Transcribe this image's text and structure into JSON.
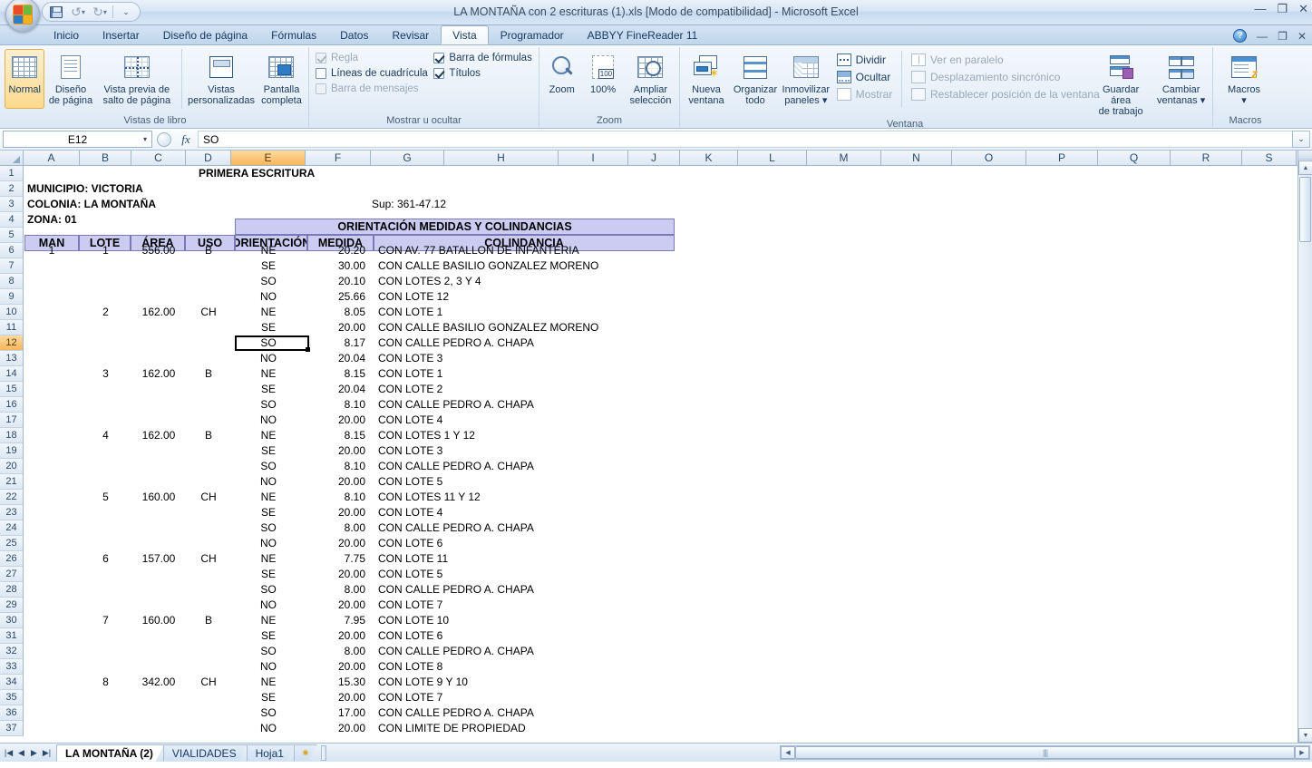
{
  "window": {
    "title": "LA MONTAÑA con 2 escrituras (1).xls  [Modo de compatibilidad] - Microsoft Excel",
    "minimize": "—",
    "restore": "❐",
    "close": "✕",
    "app_minimize": "—",
    "app_restore": "❐",
    "app_close": "✕",
    "help": "?"
  },
  "quick_access": {
    "save": "save-icon",
    "undo": "↺",
    "redo": "↻",
    "customize": "⌄"
  },
  "tabs": [
    {
      "label": "Inicio",
      "active": false
    },
    {
      "label": "Insertar",
      "active": false
    },
    {
      "label": "Diseño de página",
      "active": false
    },
    {
      "label": "Fórmulas",
      "active": false
    },
    {
      "label": "Datos",
      "active": false
    },
    {
      "label": "Revisar",
      "active": false
    },
    {
      "label": "Vista",
      "active": true
    },
    {
      "label": "Programador",
      "active": false
    },
    {
      "label": "ABBYY FineReader 11",
      "active": false
    }
  ],
  "ribbon": {
    "groups": [
      {
        "name": "Vistas de libro",
        "label": "Vistas de libro",
        "buttons": [
          {
            "label_line1": "Normal",
            "label_line2": "",
            "selected": true
          },
          {
            "label_line1": "Diseño",
            "label_line2": "de página",
            "selected": false
          },
          {
            "label_line1": "Vista previa de",
            "label_line2": "salto de página",
            "selected": false
          },
          {
            "label_line1": "Vistas",
            "label_line2": "personalizadas",
            "selected": false
          },
          {
            "label_line1": "Pantalla",
            "label_line2": "completa",
            "selected": false
          }
        ]
      },
      {
        "name": "Mostrar u ocultar",
        "label": "Mostrar u ocultar",
        "checkboxes": [
          {
            "label": "Regla",
            "checked": true,
            "disabled": true
          },
          {
            "label": "Líneas de cuadrícula",
            "checked": false,
            "disabled": false
          },
          {
            "label": "Barra de mensajes",
            "checked": false,
            "disabled": true
          },
          {
            "label": "Barra de fórmulas",
            "checked": true,
            "disabled": false
          },
          {
            "label": "Títulos",
            "checked": true,
            "disabled": false
          }
        ]
      },
      {
        "name": "Zoom",
        "label": "Zoom",
        "buttons": [
          {
            "label_line1": "Zoom",
            "label_line2": ""
          },
          {
            "label_line1": "100%",
            "label_line2": ""
          },
          {
            "label_line1": "Ampliar",
            "label_line2": "selección"
          }
        ]
      },
      {
        "name": "Ventana",
        "label": "Ventana",
        "buttons": [
          {
            "label_line1": "Nueva",
            "label_line2": "ventana"
          },
          {
            "label_line1": "Organizar",
            "label_line2": "todo"
          },
          {
            "label_line1": "Inmovilizar",
            "label_line2": "paneles ▾"
          }
        ],
        "small_buttons": [
          {
            "label": "Dividir",
            "disabled": false
          },
          {
            "label": "Ocultar",
            "disabled": false
          },
          {
            "label": "Mostrar",
            "disabled": true
          },
          {
            "label": "Ver en paralelo",
            "disabled": true
          },
          {
            "label": "Desplazamiento sincrónico",
            "disabled": true
          },
          {
            "label": "Restablecer posición de la ventana",
            "disabled": true
          }
        ],
        "buttons2": [
          {
            "label_line1": "Guardar área",
            "label_line2": "de trabajo"
          },
          {
            "label_line1": "Cambiar",
            "label_line2": "ventanas ▾"
          }
        ]
      },
      {
        "name": "Macros",
        "label": "Macros",
        "buttons": [
          {
            "label_line1": "Macros",
            "label_line2": "▾"
          }
        ]
      }
    ]
  },
  "formula_bar": {
    "name_box": "E12",
    "name_box_caret": "▾",
    "fx": "fx",
    "value": "SO",
    "expand": "⌄"
  },
  "grid": {
    "column_headers": [
      "A",
      "B",
      "C",
      "D",
      "E",
      "F",
      "G",
      "H",
      "I",
      "J",
      "K",
      "L",
      "M",
      "N",
      "O",
      "P",
      "Q",
      "R",
      "S"
    ],
    "selected_column": "E",
    "selected_row": 12,
    "selected_cell": "E12",
    "row_numbers": [
      1,
      2,
      3,
      4,
      5,
      6,
      7,
      8,
      9,
      10,
      11,
      12,
      13,
      14,
      15,
      16,
      17,
      18,
      19,
      20,
      21,
      22,
      23,
      24,
      25,
      26,
      27,
      28,
      29,
      30,
      31,
      32,
      33,
      34,
      35,
      36,
      37
    ],
    "titles": {
      "primera_escritura": "PRIMERA ESCRITURA",
      "municipio": "MUNICIPIO: VICTORIA",
      "colonia": "COLONIA: LA MONTAÑA",
      "zona": "ZONA: 01",
      "sup": "Sup: 361-47.12",
      "band": "ORIENTACIÓN MEDIDAS Y COLINDANCIAS"
    },
    "table_headers": [
      "MAN",
      "LOTE",
      "ÁREA",
      "USO",
      "ORIENTACIÓN",
      "MEDIDA",
      "COLINDANCIA"
    ],
    "rows": [
      {
        "row": 6,
        "man": "1",
        "lote": "1",
        "area": "556.00",
        "uso": "B",
        "orient": "NE",
        "medida": "20.20",
        "colindancia": "CON AV. 77 BATALLON DE INFANTERIA"
      },
      {
        "row": 7,
        "man": "",
        "lote": "",
        "area": "",
        "uso": "",
        "orient": "SE",
        "medida": "30.00",
        "colindancia": "CON CALLE BASILIO GONZALEZ MORENO"
      },
      {
        "row": 8,
        "man": "",
        "lote": "",
        "area": "",
        "uso": "",
        "orient": "SO",
        "medida": "20.10",
        "colindancia": "CON LOTES 2, 3 Y 4"
      },
      {
        "row": 9,
        "man": "",
        "lote": "",
        "area": "",
        "uso": "",
        "orient": "NO",
        "medida": "25.66",
        "colindancia": "CON LOTE 12"
      },
      {
        "row": 10,
        "man": "",
        "lote": "2",
        "area": "162.00",
        "uso": "CH",
        "orient": "NE",
        "medida": "8.05",
        "colindancia": "CON LOTE 1"
      },
      {
        "row": 11,
        "man": "",
        "lote": "",
        "area": "",
        "uso": "",
        "orient": "SE",
        "medida": "20.00",
        "colindancia": "CON CALLE BASILIO GONZALEZ MORENO"
      },
      {
        "row": 12,
        "man": "",
        "lote": "",
        "area": "",
        "uso": "",
        "orient": "SO",
        "medida": "8.17",
        "colindancia": "CON CALLE PEDRO A. CHAPA"
      },
      {
        "row": 13,
        "man": "",
        "lote": "",
        "area": "",
        "uso": "",
        "orient": "NO",
        "medida": "20.04",
        "colindancia": "CON LOTE 3"
      },
      {
        "row": 14,
        "man": "",
        "lote": "3",
        "area": "162.00",
        "uso": "B",
        "orient": "NE",
        "medida": "8.15",
        "colindancia": "CON LOTE 1"
      },
      {
        "row": 15,
        "man": "",
        "lote": "",
        "area": "",
        "uso": "",
        "orient": "SE",
        "medida": "20.04",
        "colindancia": "CON LOTE 2"
      },
      {
        "row": 16,
        "man": "",
        "lote": "",
        "area": "",
        "uso": "",
        "orient": "SO",
        "medida": "8.10",
        "colindancia": "CON CALLE PEDRO A. CHAPA"
      },
      {
        "row": 17,
        "man": "",
        "lote": "",
        "area": "",
        "uso": "",
        "orient": "NO",
        "medida": "20.00",
        "colindancia": "CON LOTE 4"
      },
      {
        "row": 18,
        "man": "",
        "lote": "4",
        "area": "162.00",
        "uso": "B",
        "orient": "NE",
        "medida": "8.15",
        "colindancia": "CON LOTES 1 Y 12"
      },
      {
        "row": 19,
        "man": "",
        "lote": "",
        "area": "",
        "uso": "",
        "orient": "SE",
        "medida": "20.00",
        "colindancia": "CON LOTE 3"
      },
      {
        "row": 20,
        "man": "",
        "lote": "",
        "area": "",
        "uso": "",
        "orient": "SO",
        "medida": "8.10",
        "colindancia": "CON CALLE PEDRO A. CHAPA"
      },
      {
        "row": 21,
        "man": "",
        "lote": "",
        "area": "",
        "uso": "",
        "orient": "NO",
        "medida": "20.00",
        "colindancia": "CON LOTE 5"
      },
      {
        "row": 22,
        "man": "",
        "lote": "5",
        "area": "160.00",
        "uso": "CH",
        "orient": "NE",
        "medida": "8.10",
        "colindancia": "CON LOTES 11 Y 12"
      },
      {
        "row": 23,
        "man": "",
        "lote": "",
        "area": "",
        "uso": "",
        "orient": "SE",
        "medida": "20.00",
        "colindancia": "CON LOTE 4"
      },
      {
        "row": 24,
        "man": "",
        "lote": "",
        "area": "",
        "uso": "",
        "orient": "SO",
        "medida": "8.00",
        "colindancia": "CON CALLE PEDRO A. CHAPA"
      },
      {
        "row": 25,
        "man": "",
        "lote": "",
        "area": "",
        "uso": "",
        "orient": "NO",
        "medida": "20.00",
        "colindancia": "CON LOTE 6"
      },
      {
        "row": 26,
        "man": "",
        "lote": "6",
        "area": "157.00",
        "uso": "CH",
        "orient": "NE",
        "medida": "7.75",
        "colindancia": "CON LOTE 11"
      },
      {
        "row": 27,
        "man": "",
        "lote": "",
        "area": "",
        "uso": "",
        "orient": "SE",
        "medida": "20.00",
        "colindancia": "CON LOTE 5"
      },
      {
        "row": 28,
        "man": "",
        "lote": "",
        "area": "",
        "uso": "",
        "orient": "SO",
        "medida": "8.00",
        "colindancia": "CON CALLE PEDRO A. CHAPA"
      },
      {
        "row": 29,
        "man": "",
        "lote": "",
        "area": "",
        "uso": "",
        "orient": "NO",
        "medida": "20.00",
        "colindancia": "CON LOTE 7"
      },
      {
        "row": 30,
        "man": "",
        "lote": "7",
        "area": "160.00",
        "uso": "B",
        "orient": "NE",
        "medida": "7.95",
        "colindancia": "CON LOTE 10"
      },
      {
        "row": 31,
        "man": "",
        "lote": "",
        "area": "",
        "uso": "",
        "orient": "SE",
        "medida": "20.00",
        "colindancia": "CON LOTE 6"
      },
      {
        "row": 32,
        "man": "",
        "lote": "",
        "area": "",
        "uso": "",
        "orient": "SO",
        "medida": "8.00",
        "colindancia": "CON CALLE PEDRO A. CHAPA"
      },
      {
        "row": 33,
        "man": "",
        "lote": "",
        "area": "",
        "uso": "",
        "orient": "NO",
        "medida": "20.00",
        "colindancia": "CON LOTE 8"
      },
      {
        "row": 34,
        "man": "",
        "lote": "8",
        "area": "342.00",
        "uso": "CH",
        "orient": "NE",
        "medida": "15.30",
        "colindancia": "CON LOTE 9 Y 10"
      },
      {
        "row": 35,
        "man": "",
        "lote": "",
        "area": "",
        "uso": "",
        "orient": "SE",
        "medida": "20.00",
        "colindancia": "CON LOTE 7"
      },
      {
        "row": 36,
        "man": "",
        "lote": "",
        "area": "",
        "uso": "",
        "orient": "SO",
        "medida": "17.00",
        "colindancia": "CON CALLE PEDRO A. CHAPA"
      },
      {
        "row": 37,
        "man": "",
        "lote": "",
        "area": "",
        "uso": "",
        "orient": "NO",
        "medida": "20.00",
        "colindancia": "CON LIMITE DE PROPIEDAD"
      }
    ]
  },
  "sheet_tabs": {
    "nav": {
      "first": "|◀",
      "prev": "◀",
      "next": "▶",
      "last": "▶|"
    },
    "tabs": [
      {
        "label": "LA MONTAÑA (2)",
        "active": true
      },
      {
        "label": "VIALIDADES",
        "active": false
      },
      {
        "label": "Hoja1",
        "active": false
      }
    ],
    "new_sheet_icon": "new-sheet-icon"
  },
  "colors": {
    "header_band": "#ccccf3",
    "header_border": "#7a7ab8",
    "selection": "#f9b75a",
    "accent": "#17375e"
  }
}
